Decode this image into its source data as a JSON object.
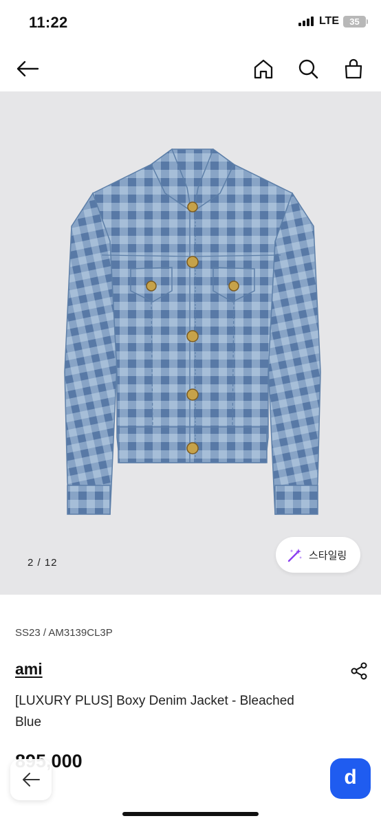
{
  "status_bar": {
    "time": "11:22",
    "network": "LTE",
    "battery": "35"
  },
  "nav": {
    "icons": [
      "back-arrow-icon",
      "home-icon",
      "search-icon",
      "shopping-bag-icon"
    ]
  },
  "gallery": {
    "image": "plaid-denim-jacket",
    "counter": "2 / 12",
    "current_index": 2,
    "total": 12,
    "styling_label": "스타일링",
    "background": "#e6e6e8"
  },
  "product": {
    "code": "SS23 / AM3139CL3P",
    "brand": "ami",
    "name": "[LUXURY PLUS] Boxy Denim Jacket - Bleached Blue",
    "price": "895,000"
  },
  "floating": {
    "d_label": "d",
    "d_color": "#1f5cf0"
  }
}
